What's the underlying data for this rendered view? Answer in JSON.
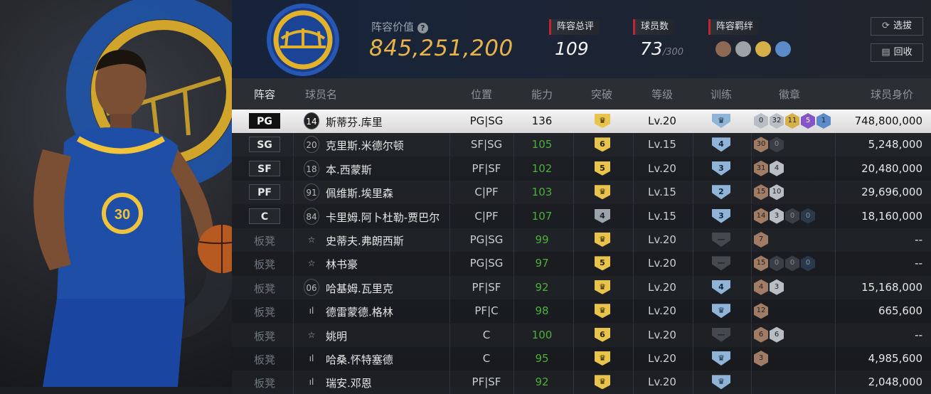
{
  "header": {
    "value_label": "阵容价值",
    "help_icon": "help-icon",
    "value": "845,251,200",
    "rating_label": "阵容总评",
    "rating": "109",
    "count_label": "球员数",
    "count": "73",
    "count_max": "/300",
    "chem_label": "阵容羁绊",
    "select_button": "选拔",
    "recycle_button": "回收",
    "accent": "#e8b34a",
    "label_marker": "#c0262b"
  },
  "columns": [
    "阵容",
    "球员名",
    "位置",
    "能力",
    "突破",
    "等级",
    "训练",
    "徽章",
    "球员身价"
  ],
  "rows": [
    {
      "slot": "PG",
      "bench": false,
      "num": "14",
      "num_type": "circle",
      "name": "斯蒂芬.库里",
      "pos": "PG|SG",
      "ability": "136",
      "breakthrough": "crown",
      "break_color": "gold",
      "level": "Lv.20",
      "training": "crown",
      "training_style": "blue",
      "badges": [
        {
          "v": "0",
          "c": "sv"
        },
        {
          "v": "32",
          "c": "sv"
        },
        {
          "v": "11",
          "c": "gd"
        },
        {
          "v": "5",
          "c": "pu"
        },
        {
          "v": "1",
          "c": "bl"
        }
      ],
      "price": "748,800,000",
      "selected": true
    },
    {
      "slot": "SG",
      "bench": false,
      "num": "20",
      "num_type": "circle",
      "name": "克里斯.米德尔顿",
      "pos": "SF|SG",
      "ability": "105",
      "breakthrough": "6",
      "break_color": "gold",
      "level": "Lv.15",
      "training": "4",
      "training_style": "blue",
      "badges": [
        {
          "v": "30",
          "c": "br"
        },
        {
          "v": "0",
          "c": "dk"
        }
      ],
      "price": "5,248,000"
    },
    {
      "slot": "SF",
      "bench": false,
      "num": "18",
      "num_type": "circle",
      "name": "本.西蒙斯",
      "pos": "PF|SF",
      "ability": "102",
      "breakthrough": "5",
      "break_color": "gold",
      "level": "Lv.20",
      "training": "3",
      "training_style": "blue",
      "badges": [
        {
          "v": "31",
          "c": "br"
        },
        {
          "v": "4",
          "c": "sv"
        }
      ],
      "price": "20,480,000"
    },
    {
      "slot": "PF",
      "bench": false,
      "num": "91",
      "num_type": "circle",
      "name": "佩维斯.埃里森",
      "pos": "C|PF",
      "ability": "103",
      "breakthrough": "crown",
      "break_color": "gold",
      "level": "Lv.15",
      "training": "2",
      "training_style": "blue",
      "badges": [
        {
          "v": "15",
          "c": "br"
        },
        {
          "v": "10",
          "c": "sv"
        }
      ],
      "price": "29,696,000"
    },
    {
      "slot": "C",
      "bench": false,
      "num": "84",
      "num_type": "circle",
      "name": "卡里姆.阿卜杜勒-贾巴尔",
      "pos": "C|PF",
      "ability": "107",
      "breakthrough": "4",
      "break_color": "grey",
      "level": "Lv.15",
      "training": "3",
      "training_style": "blue",
      "badges": [
        {
          "v": "14",
          "c": "br"
        },
        {
          "v": "3",
          "c": "sv"
        },
        {
          "v": "0",
          "c": "dk"
        },
        {
          "v": "0",
          "c": "dkb"
        }
      ],
      "price": "18,160,000"
    },
    {
      "slot": "板凳",
      "bench": true,
      "num": "☆",
      "num_type": "star",
      "name": "史蒂夫.弗朗西斯",
      "pos": "PG|SG",
      "ability": "99",
      "breakthrough": "crown",
      "break_color": "gold",
      "level": "Lv.20",
      "training": "",
      "training_style": "dark",
      "badges": [
        {
          "v": "7",
          "c": "br"
        }
      ],
      "price": "--"
    },
    {
      "slot": "板凳",
      "bench": true,
      "num": "☆",
      "num_type": "star",
      "name": "林书豪",
      "pos": "PG|SG",
      "ability": "97",
      "breakthrough": "5",
      "break_color": "gold",
      "level": "Lv.20",
      "training": "",
      "training_style": "dark",
      "badges": [
        {
          "v": "15",
          "c": "br"
        },
        {
          "v": "0",
          "c": "dk"
        },
        {
          "v": "0",
          "c": "dk"
        },
        {
          "v": "0",
          "c": "dkb"
        }
      ],
      "price": "--"
    },
    {
      "slot": "板凳",
      "bench": true,
      "num": "06",
      "num_type": "circle",
      "name": "哈基姆.瓦里克",
      "pos": "PF|SF",
      "ability": "92",
      "breakthrough": "crown",
      "break_color": "gold",
      "level": "Lv.20",
      "training": "4",
      "training_style": "blue",
      "badges": [
        {
          "v": "4",
          "c": "br"
        },
        {
          "v": "3",
          "c": "sv"
        }
      ],
      "price": "15,168,000"
    },
    {
      "slot": "板凳",
      "bench": true,
      "num": "ıl",
      "num_type": "bars",
      "name": "德雷蒙德.格林",
      "pos": "PF|C",
      "ability": "98",
      "breakthrough": "crown",
      "break_color": "gold",
      "level": "Lv.20",
      "training": "crown",
      "training_style": "blue",
      "badges": [
        {
          "v": "12",
          "c": "br"
        }
      ],
      "price": "665,600"
    },
    {
      "slot": "板凳",
      "bench": true,
      "num": "☆",
      "num_type": "star",
      "name": "姚明",
      "pos": "C",
      "ability": "100",
      "breakthrough": "6",
      "break_color": "gold",
      "level": "Lv.20",
      "training": "",
      "training_style": "dark",
      "badges": [
        {
          "v": "6",
          "c": "br"
        },
        {
          "v": "6",
          "c": "sv"
        }
      ],
      "price": "--"
    },
    {
      "slot": "板凳",
      "bench": true,
      "num": "ıl",
      "num_type": "bars",
      "name": "哈桑.怀特塞德",
      "pos": "C",
      "ability": "95",
      "breakthrough": "crown",
      "break_color": "gold",
      "level": "Lv.20",
      "training": "crown",
      "training_style": "blue",
      "badges": [
        {
          "v": "3",
          "c": "br"
        }
      ],
      "price": "4,985,600"
    },
    {
      "slot": "板凳",
      "bench": true,
      "num": "ıl",
      "num_type": "bars",
      "name": "瑞安.邓恩",
      "pos": "PF|SF",
      "ability": "92",
      "breakthrough": "crown",
      "break_color": "gold",
      "level": "Lv.20",
      "training": "crown",
      "training_style": "blue",
      "badges": [],
      "price": "2,048,000"
    }
  ]
}
